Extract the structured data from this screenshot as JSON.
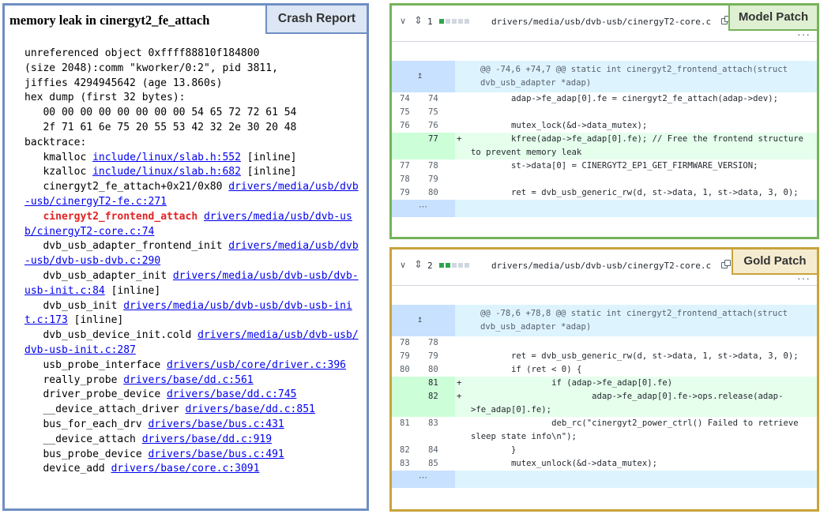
{
  "crash": {
    "title": "memory leak in cinergyt2_fe_attach",
    "tag": "Crash Report",
    "lines": [
      {
        "text": "unreferenced object 0xffff88810f184800"
      },
      {
        "text": "(size 2048):comm \"kworker/0:2\", pid 3811,"
      },
      {
        "text": "jiffies 4294945642 (age 13.860s)"
      },
      {
        "text": "hex dump (first 32 bytes):"
      },
      {
        "text": "   00 00 00 00 00 00 00 00 54 65 72 72 61 54"
      },
      {
        "text": "   2f 71 61 6e 75 20 55 53 42 32 2e 30 20 48"
      },
      {
        "text": "backtrace:"
      }
    ],
    "frames": [
      {
        "fn": "   kmalloc ",
        "link": "include/linux/slab.h:552",
        "suffix": " [inline]",
        "highlight": false
      },
      {
        "fn": "   kzalloc ",
        "link": "include/linux/slab.h:682",
        "suffix": " [inline]",
        "highlight": false
      },
      {
        "fn": "   cinergyt2_fe_attach+0x21/0x80 ",
        "link": "drivers/media/usb/dvb-usb/cinergyT2-fe.c:271",
        "suffix": "",
        "highlight": false
      },
      {
        "fn": "   cinergyt2_frontend_attach",
        "link": "drivers/media/usb/dvb-usb/cinergyT2-core.c:74",
        "suffix": "",
        "highlight": true
      },
      {
        "fn": "   dvb_usb_adapter_frontend_init ",
        "link": "drivers/media/usb/dvb-usb/dvb-usb-dvb.c:290",
        "suffix": "",
        "highlight": false
      },
      {
        "fn": "   dvb_usb_adapter_init ",
        "link": "drivers/media/usb/dvb-usb/dvb-usb-init.c:84",
        "suffix": " [inline]",
        "highlight": false
      },
      {
        "fn": "   dvb_usb_init ",
        "link": "drivers/media/usb/dvb-usb/dvb-usb-init.c:173",
        "suffix": " [inline]",
        "highlight": false
      },
      {
        "fn": "   dvb_usb_device_init.cold ",
        "link": "drivers/media/usb/dvb-usb/dvb-usb-init.c:287",
        "suffix": "",
        "highlight": false
      },
      {
        "fn": "   usb_probe_interface ",
        "link": "drivers/usb/core/driver.c:396",
        "suffix": "",
        "highlight": false
      },
      {
        "fn": "   really_probe ",
        "link": "drivers/base/dd.c:561",
        "suffix": "",
        "highlight": false
      },
      {
        "fn": "   driver_probe_device ",
        "link": "drivers/base/dd.c:745",
        "suffix": "",
        "highlight": false
      },
      {
        "fn": "   __device_attach_driver ",
        "link": "drivers/base/dd.c:851",
        "suffix": "",
        "highlight": false
      },
      {
        "fn": "   bus_for_each_drv ",
        "link": "drivers/base/bus.c:431",
        "suffix": "",
        "highlight": false
      },
      {
        "fn": "   __device_attach ",
        "link": "drivers/base/dd.c:919",
        "suffix": "",
        "highlight": false
      },
      {
        "fn": "   bus_probe_device ",
        "link": "drivers/base/bus.c:491",
        "suffix": "",
        "highlight": false
      },
      {
        "fn": "   device_add ",
        "link": "drivers/base/core.c:3091",
        "suffix": "",
        "highlight": false
      }
    ]
  },
  "model_patch": {
    "tag": "Model Patch",
    "count": "1",
    "squares": [
      "#2da44e",
      "#d0d7de",
      "#d0d7de",
      "#d0d7de",
      "#d0d7de"
    ],
    "file": "drivers/media/usb/dvb-usb/cinergyT2-core.c",
    "hunk": "@@ -74,6 +74,7 @@ static int cinergyt2_frontend_attach(struct dvb_usb_adapter *adap)",
    "lines": [
      {
        "type": "ctx",
        "old": "74",
        "new": "74",
        "sign": "",
        "code": "        adap->fe_adap[0].fe = cinergyt2_fe_attach(adap->dev);"
      },
      {
        "type": "ctx",
        "old": "75",
        "new": "75",
        "sign": "",
        "code": ""
      },
      {
        "type": "ctx",
        "old": "76",
        "new": "76",
        "sign": "",
        "code": "        mutex_lock(&d->data_mutex);"
      },
      {
        "type": "add",
        "old": "",
        "new": "77",
        "sign": "+",
        "code": "        kfree(adap->fe_adap[0].fe); // Free the frontend structure to prevent memory leak"
      },
      {
        "type": "ctx",
        "old": "77",
        "new": "78",
        "sign": "",
        "code": "        st->data[0] = CINERGYT2_EP1_GET_FIRMWARE_VERSION;"
      },
      {
        "type": "ctx",
        "old": "78",
        "new": "79",
        "sign": "",
        "code": ""
      },
      {
        "type": "ctx",
        "old": "79",
        "new": "80",
        "sign": "",
        "code": "        ret = dvb_usb_generic_rw(d, st->data, 1, st->data, 3, 0);"
      }
    ]
  },
  "gold_patch": {
    "tag": "Gold Patch",
    "count": "2",
    "squares": [
      "#2da44e",
      "#2da44e",
      "#d0d7de",
      "#d0d7de",
      "#d0d7de"
    ],
    "file": "drivers/media/usb/dvb-usb/cinergyT2-core.c",
    "hunk": "@@ -78,6 +78,8 @@ static int cinergyt2_frontend_attach(struct dvb_usb_adapter *adap)",
    "lines": [
      {
        "type": "ctx",
        "old": "78",
        "new": "78",
        "sign": "",
        "code": ""
      },
      {
        "type": "ctx",
        "old": "79",
        "new": "79",
        "sign": "",
        "code": "        ret = dvb_usb_generic_rw(d, st->data, 1, st->data, 3, 0);"
      },
      {
        "type": "ctx",
        "old": "80",
        "new": "80",
        "sign": "",
        "code": "        if (ret < 0) {"
      },
      {
        "type": "add",
        "old": "",
        "new": "81",
        "sign": "+",
        "code": "                if (adap->fe_adap[0].fe)"
      },
      {
        "type": "add",
        "old": "",
        "new": "82",
        "sign": "+",
        "code": "                        adap->fe_adap[0].fe->ops.release(adap->fe_adap[0].fe);"
      },
      {
        "type": "ctx",
        "old": "81",
        "new": "83",
        "sign": "",
        "code": "                deb_rc(\"cinergyt2_power_ctrl() Failed to retrieve sleep state info\\n\");"
      },
      {
        "type": "ctx",
        "old": "82",
        "new": "84",
        "sign": "",
        "code": "        }"
      },
      {
        "type": "ctx",
        "old": "83",
        "new": "85",
        "sign": "",
        "code": "        mutex_unlock(&d->data_mutex);"
      }
    ]
  },
  "icons": {
    "chevron": "chevron-down-icon",
    "move": "move-vertical-icon",
    "copy": "copy-icon",
    "more": "more-horizontal-icon",
    "expand_up": "expand-up-icon",
    "expand_down": "expand-down-icon"
  }
}
